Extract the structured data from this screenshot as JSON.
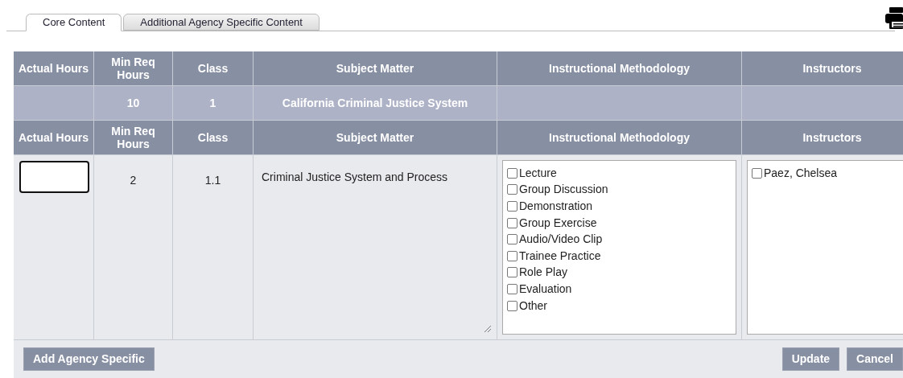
{
  "tabs": [
    {
      "label": "Core Content",
      "selected": true
    },
    {
      "label": "Additional Agency Specific Content",
      "selected": false
    }
  ],
  "table": {
    "columns": [
      "Actual Hours",
      "Min Req Hours",
      "Class",
      "Subject Matter",
      "Instructional Methodology",
      "Instructors"
    ],
    "group_row": {
      "min_req_hours": "10",
      "class": "1",
      "subject_matter": "California Criminal Justice System"
    },
    "sub_columns": [
      "Actual Hours",
      "Min Req Hours",
      "Class",
      "Subject Matter",
      "Instructional Methodology",
      "Instructors"
    ],
    "rows": [
      {
        "min_req_hours": "2",
        "class": "1.1",
        "subject_matter": "Criminal Justice System and Process",
        "methodologies": [
          {
            "label": "Lecture",
            "checked": false
          },
          {
            "label": "Group Discussion",
            "checked": false
          },
          {
            "label": "Demonstration",
            "checked": false
          },
          {
            "label": "Group Exercise",
            "checked": false
          },
          {
            "label": "Audio/Video Clip",
            "checked": false
          },
          {
            "label": "Trainee Practice",
            "checked": false
          },
          {
            "label": "Role Play",
            "checked": false
          },
          {
            "label": "Evaluation",
            "checked": false
          },
          {
            "label": "Other",
            "checked": false
          }
        ],
        "instructors": [
          {
            "label": "Paez, Chelsea",
            "checked": false
          }
        ]
      }
    ]
  },
  "buttons": {
    "left": [
      "Add Agency Specific"
    ],
    "right": [
      "Update",
      "Cancel"
    ]
  }
}
